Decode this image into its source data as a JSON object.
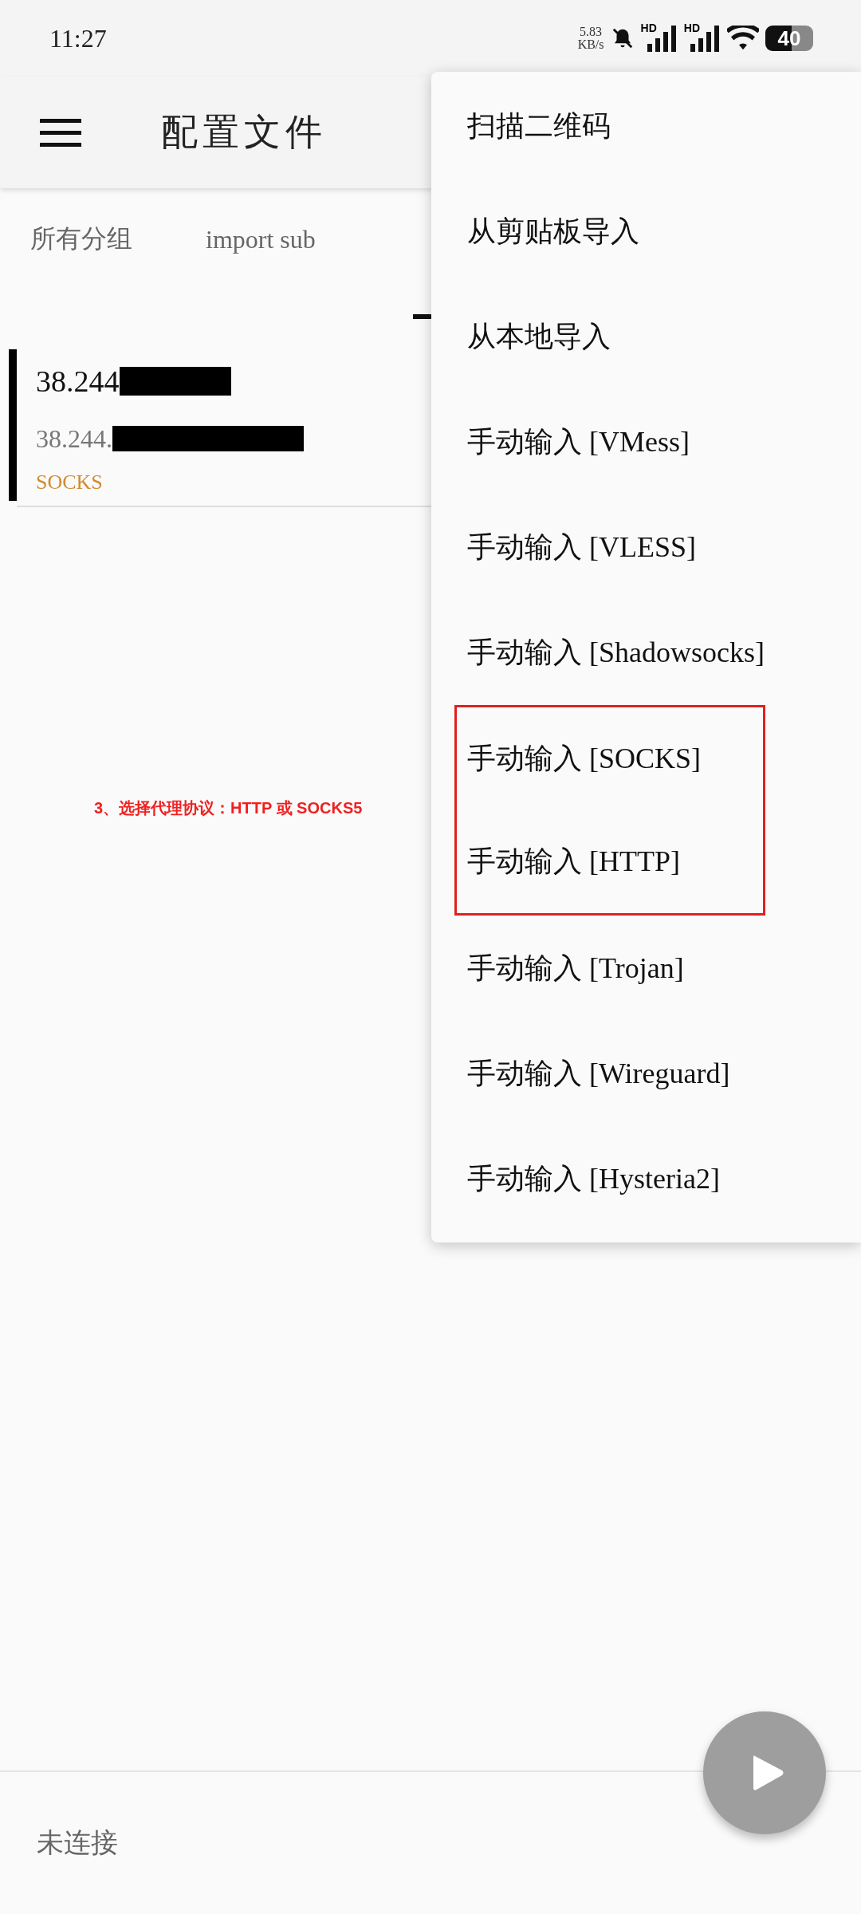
{
  "status_bar": {
    "time": "11:27",
    "net_speed": "5.83",
    "net_unit": "KB/s",
    "signal_labels": [
      "HD",
      "HD"
    ],
    "battery": "40"
  },
  "app_bar": {
    "title": "配置文件"
  },
  "tabs": [
    {
      "label": "所有分组",
      "selected": false
    },
    {
      "label": "import sub",
      "selected": false
    },
    {
      "selected": true
    }
  ],
  "servers": [
    {
      "name": "38.244",
      "address": "38.244.",
      "protocol": "SOCKS",
      "selected": true
    }
  ],
  "annotation": "3、选择代理协议：HTTP 或 SOCKS5",
  "menu": {
    "items": [
      {
        "label": "扫描二维码",
        "highlighted": false
      },
      {
        "label": "从剪贴板导入",
        "highlighted": false
      },
      {
        "label": "从本地导入",
        "highlighted": false
      },
      {
        "label": "手动输入 [VMess]",
        "highlighted": false
      },
      {
        "label": "手动输入 [VLESS]",
        "highlighted": false
      },
      {
        "label": "手动输入 [Shadowsocks]",
        "highlighted": false
      },
      {
        "label": "手动输入 [SOCKS]",
        "highlighted": true
      },
      {
        "label": "手动输入 [HTTP]",
        "highlighted": true
      },
      {
        "label": "手动输入 [Trojan]",
        "highlighted": false
      },
      {
        "label": "手动输入 [Wireguard]",
        "highlighted": false
      },
      {
        "label": "手动输入 [Hysteria2]",
        "highlighted": false
      }
    ]
  },
  "footer": {
    "status": "未连接"
  }
}
